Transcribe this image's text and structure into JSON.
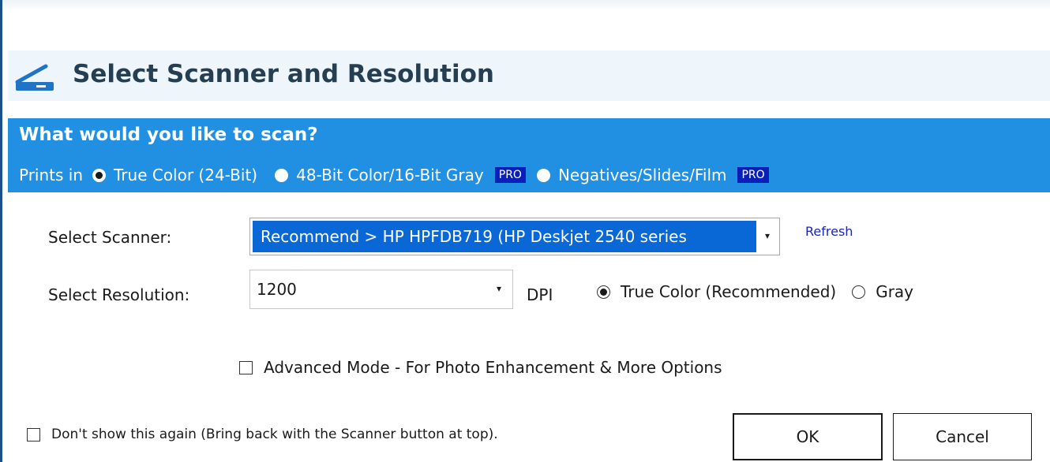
{
  "dialog": {
    "title": "Select Scanner and Resolution",
    "title_icon": "scanner-icon"
  },
  "scan_type": {
    "question": "What would you like to scan?",
    "prints_label": "Prints in",
    "options": [
      {
        "label": "True Color (24-Bit)",
        "selected": true,
        "badge": ""
      },
      {
        "label": "48-Bit Color/16-Bit Gray",
        "selected": false,
        "badge": "PRO"
      },
      {
        "label": "Negatives/Slides/Film",
        "selected": false,
        "badge": "PRO"
      }
    ]
  },
  "scanner": {
    "label": "Select Scanner:",
    "selected_value": "Recommend > HP HPFDB719 (HP Deskjet 2540 series",
    "refresh_label": "Refresh"
  },
  "resolution": {
    "label": "Select Resolution:",
    "selected_value": "1200",
    "unit": "DPI",
    "color_options": [
      {
        "label": "True Color (Recommended)",
        "selected": true
      },
      {
        "label": "Gray",
        "selected": false
      }
    ]
  },
  "advanced": {
    "label": "Advanced Mode - For Photo Enhancement & More Options",
    "checked": false
  },
  "dont_show": {
    "label": "Don't show this again (Bring back with the Scanner button at top).",
    "checked": false
  },
  "buttons": {
    "ok": "OK",
    "cancel": "Cancel"
  },
  "colors": {
    "accent_band": "#2190e3",
    "header_bg": "#eef5fb",
    "title_text": "#243f52",
    "selection": "#0a68d6",
    "pro_badge": "#0a1fb8",
    "link": "#1a24b8"
  }
}
